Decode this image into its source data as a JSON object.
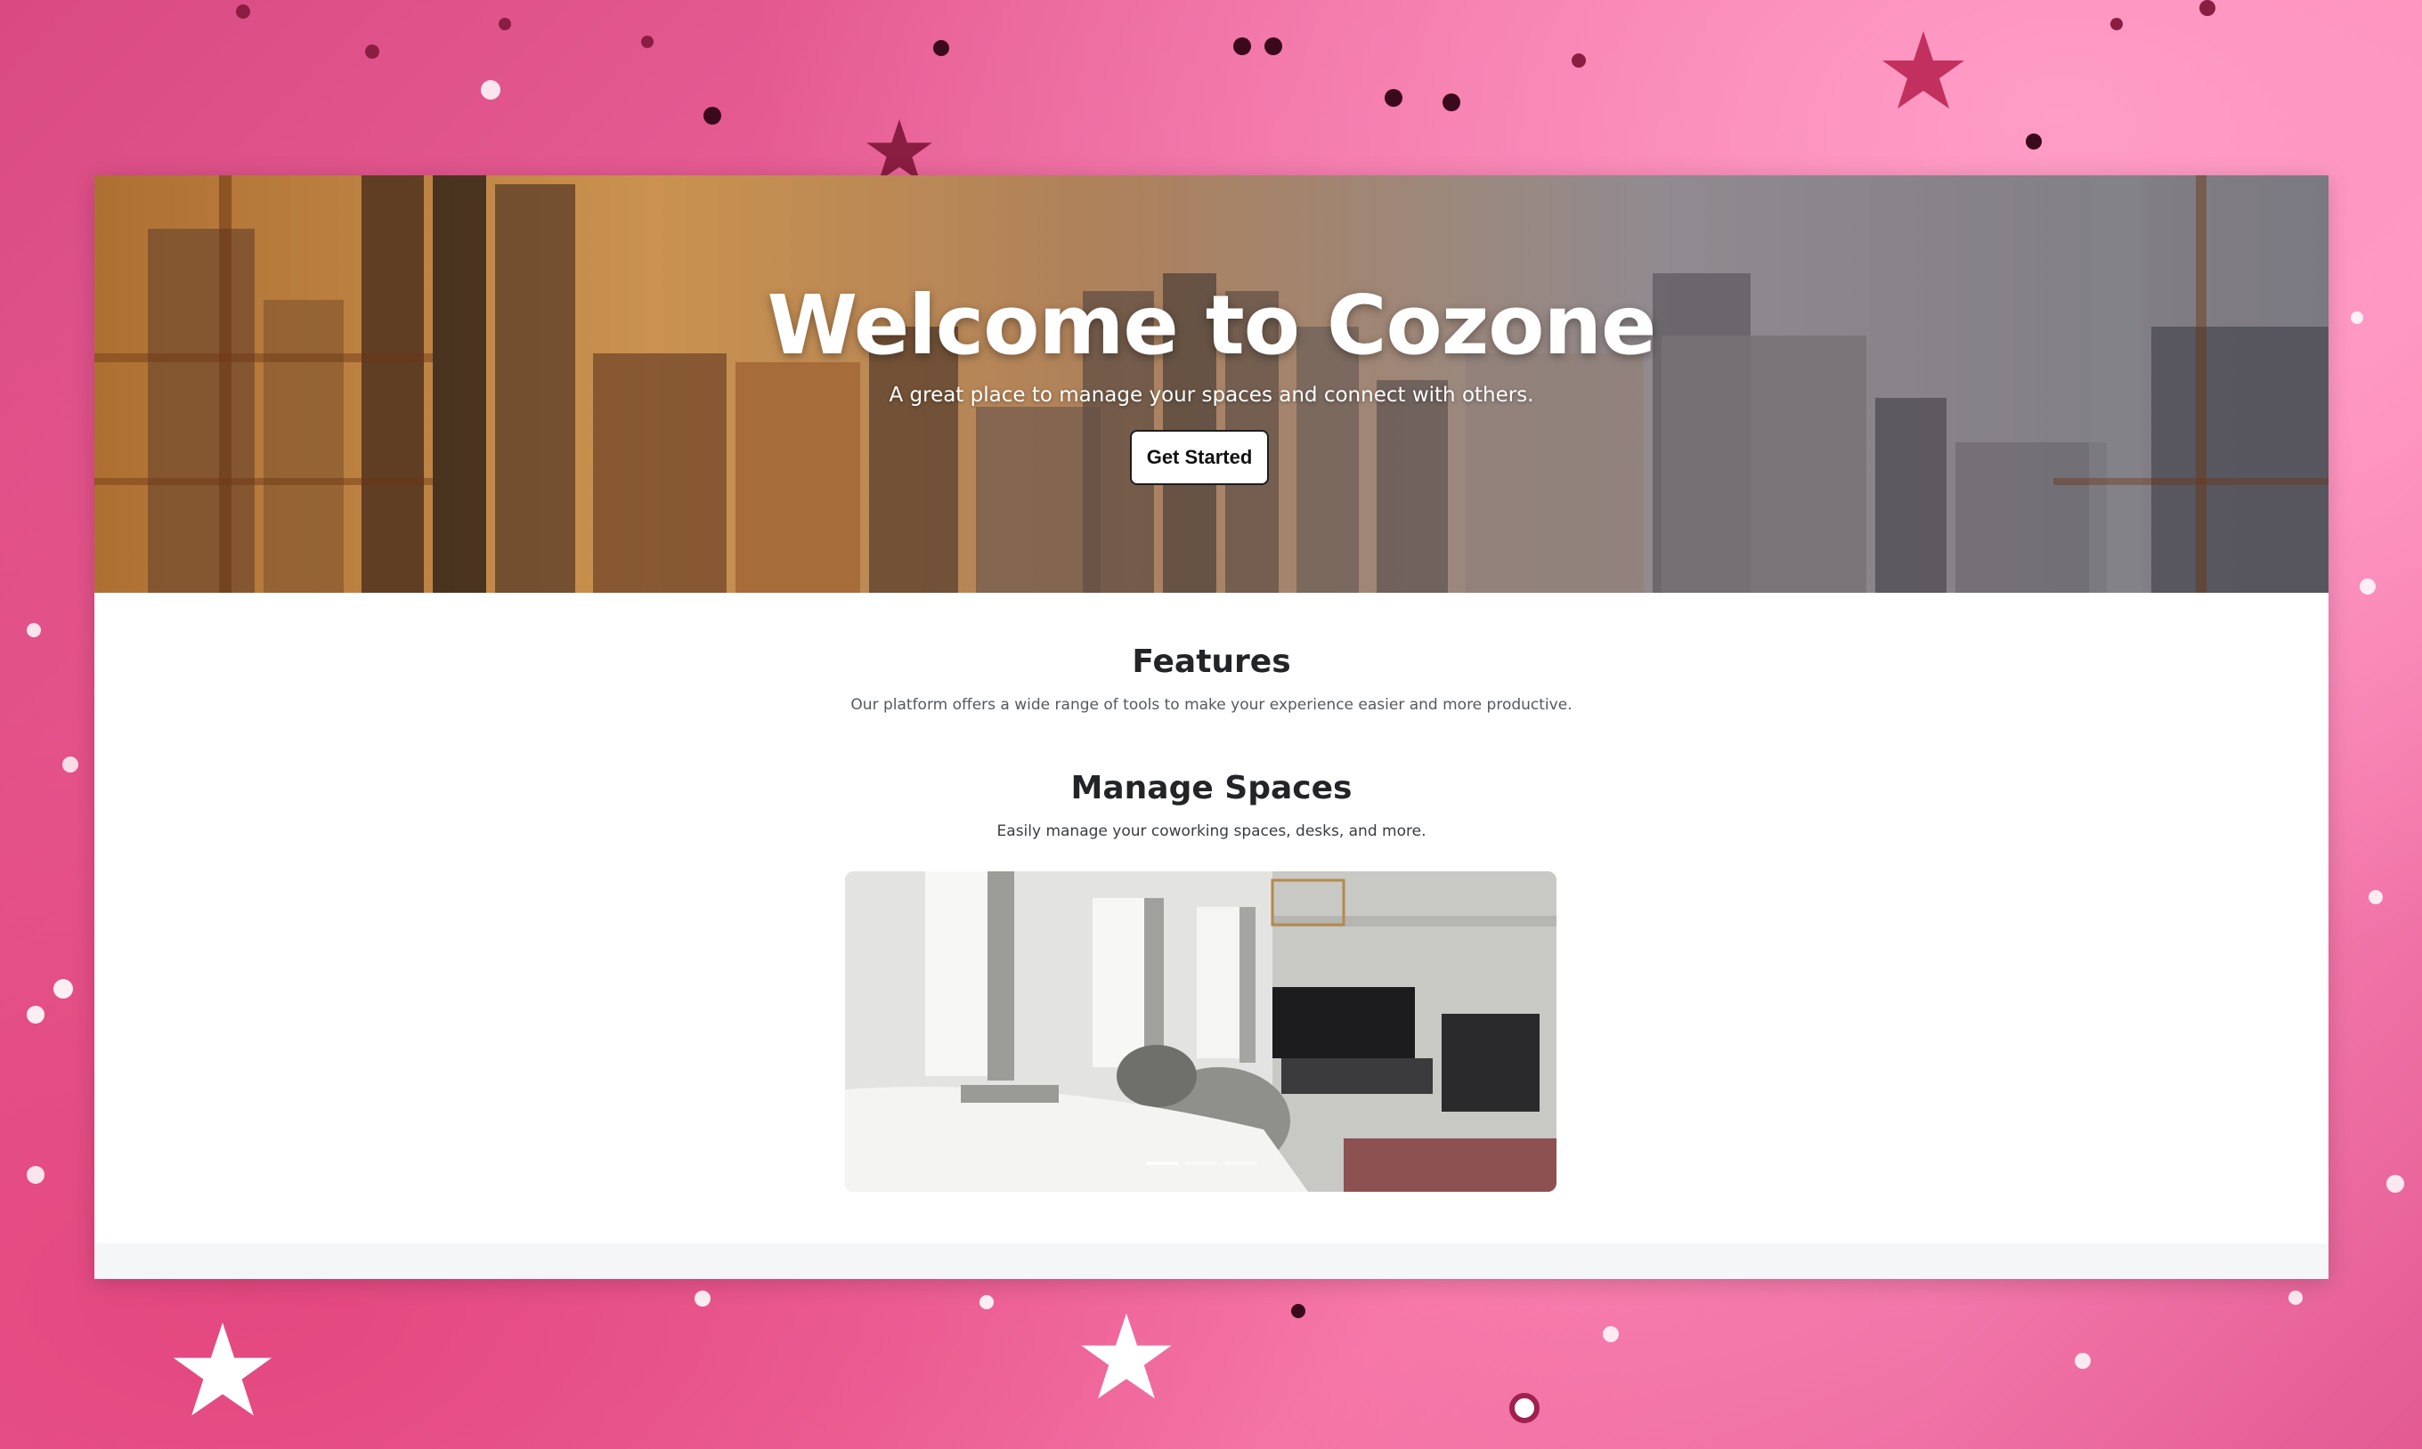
{
  "hero": {
    "title": "Welcome to Cozone",
    "subtitle": "A great place to manage your spaces and connect with others.",
    "cta_label": "Get Started"
  },
  "features": {
    "title": "Features",
    "description": "Our platform offers a wide range of tools to make your experience easier and more productive."
  },
  "manage_spaces": {
    "title": "Manage Spaces",
    "description": "Easily manage your coworking spaces, desks, and more.",
    "slides": 3,
    "active_slide": 1
  },
  "colors": {
    "backdrop_pink": "#f06aa0",
    "page_background": "#ffffff",
    "heading_text": "#222428",
    "body_text": "#55595e",
    "button_background": "#ffffff",
    "button_border": "#1d1d1f"
  },
  "icons": [
    "star-sparkle-icon"
  ]
}
